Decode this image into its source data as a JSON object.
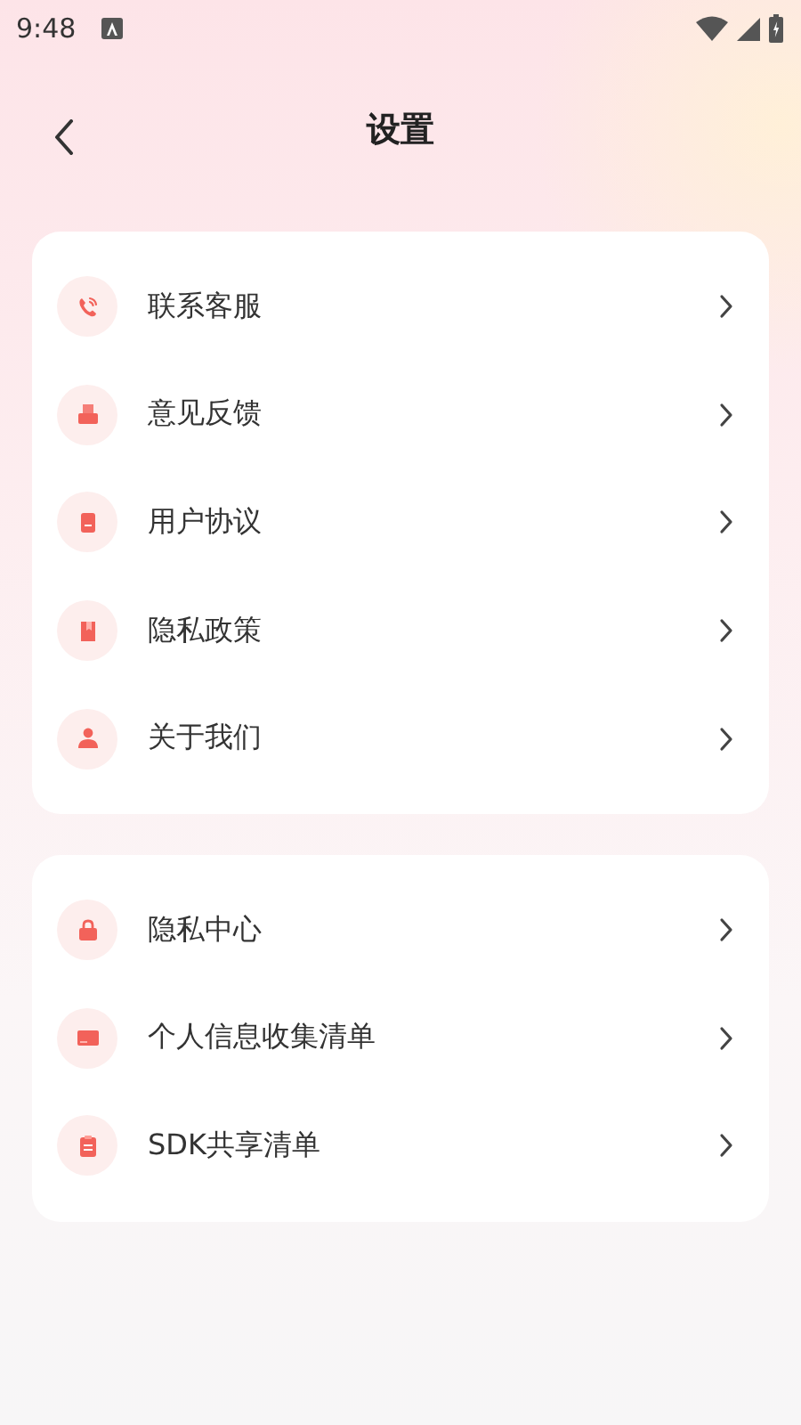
{
  "status_bar": {
    "time": "9:48"
  },
  "header": {
    "title": "设置"
  },
  "groups": [
    {
      "items": [
        {
          "label": "联系客服"
        },
        {
          "label": "意见反馈"
        },
        {
          "label": "用户协议"
        },
        {
          "label": "隐私政策"
        },
        {
          "label": "关于我们"
        }
      ]
    },
    {
      "items": [
        {
          "label": "隐私中心"
        },
        {
          "label": "个人信息收集清单"
        },
        {
          "label": "SDK共享清单"
        }
      ]
    }
  ]
}
